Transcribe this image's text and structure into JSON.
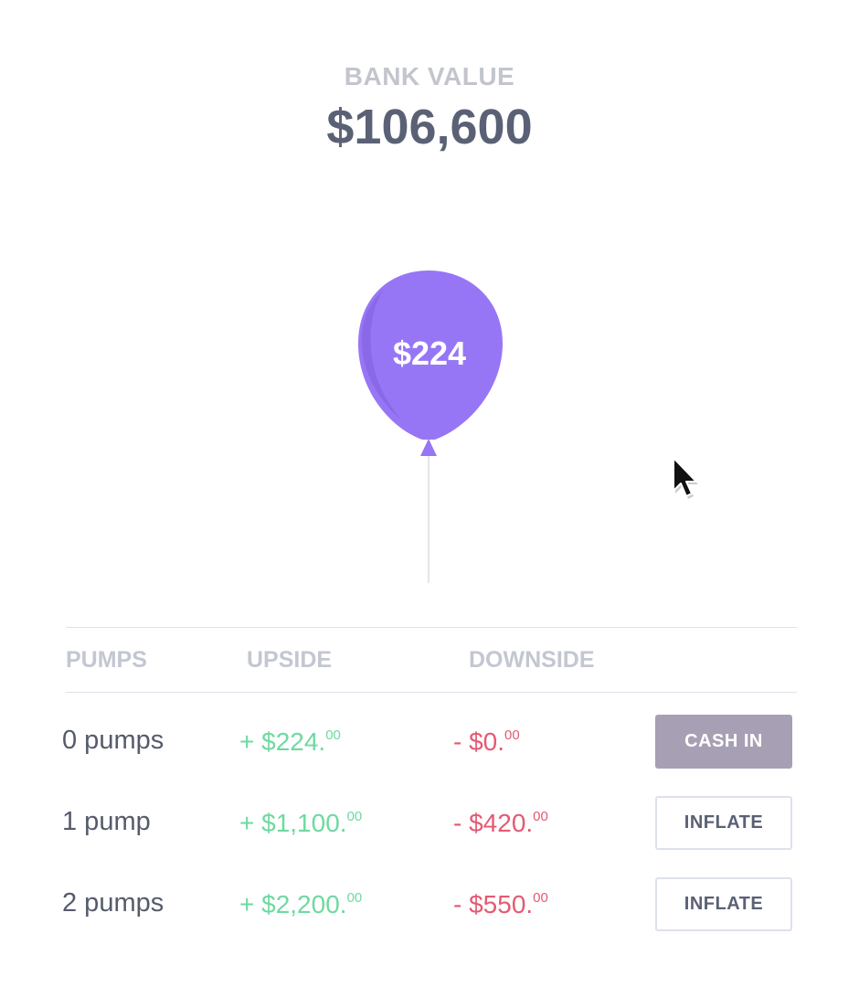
{
  "header": {
    "label": "BANK VALUE",
    "value": "$106,600"
  },
  "balloon": {
    "amount": "$224",
    "color": "#9776f6"
  },
  "table": {
    "columns": [
      "PUMPS",
      "UPSIDE",
      "DOWNSIDE"
    ],
    "rows": [
      {
        "pumps": "0 pumps",
        "upside_main": "+ $224.",
        "upside_cents": "00",
        "downside_main": "- $0.",
        "downside_cents": "00",
        "action": "CASH IN"
      },
      {
        "pumps": "1 pump",
        "upside_main": "+ $1,100.",
        "upside_cents": "00",
        "downside_main": "- $420.",
        "downside_cents": "00",
        "action": "INFLATE"
      },
      {
        "pumps": "2 pumps",
        "upside_main": "+ $2,200.",
        "upside_cents": "00",
        "downside_main": "- $550.",
        "downside_cents": "00",
        "action": "INFLATE"
      }
    ]
  },
  "colors": {
    "upside": "#6fd9a0",
    "downside": "#e45a72",
    "cash_in_button": "#a79fb3",
    "heading": "#5b6175"
  },
  "icons": {
    "cursor": "mouse-pointer-icon"
  }
}
